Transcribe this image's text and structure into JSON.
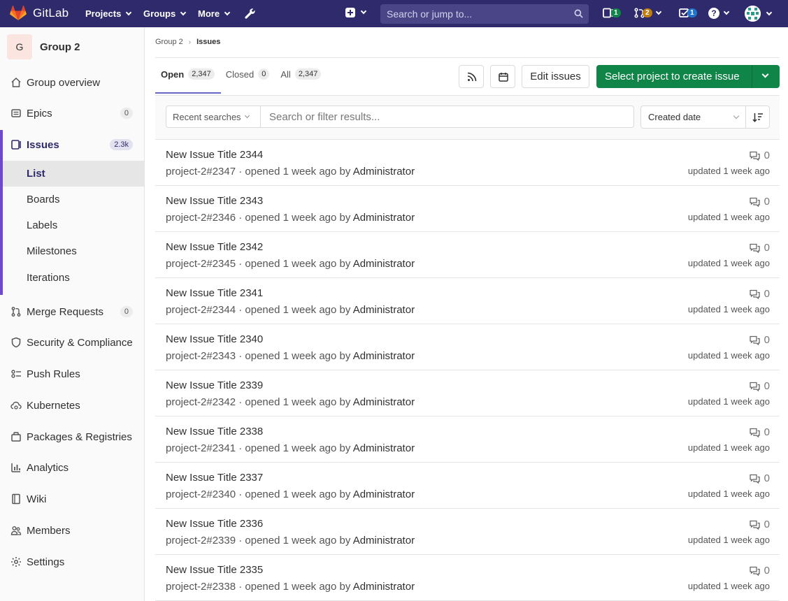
{
  "topbar": {
    "brand": "GitLab",
    "nav": [
      {
        "label": "Projects"
      },
      {
        "label": "Groups"
      },
      {
        "label": "More"
      }
    ],
    "search_placeholder": "Search or jump to...",
    "counters": {
      "issues": "1",
      "merge_requests": "2",
      "todos": "1"
    },
    "help_label": "?"
  },
  "sidebar": {
    "group_initial": "G",
    "group_name": "Group 2",
    "items": [
      {
        "label": "Group overview",
        "icon": "home-icon"
      },
      {
        "label": "Epics",
        "icon": "epic-icon",
        "badge": "0"
      },
      {
        "label": "Issues",
        "icon": "issues-icon",
        "badge": "2.3k"
      },
      {
        "label": "Merge Requests",
        "icon": "merge-request-icon",
        "badge": "0"
      },
      {
        "label": "Security & Compliance",
        "icon": "shield-icon"
      },
      {
        "label": "Push Rules",
        "icon": "push-rules-icon"
      },
      {
        "label": "Kubernetes",
        "icon": "cloud-gear-icon"
      },
      {
        "label": "Packages & Registries",
        "icon": "package-icon"
      },
      {
        "label": "Analytics",
        "icon": "chart-icon"
      },
      {
        "label": "Wiki",
        "icon": "book-icon"
      },
      {
        "label": "Members",
        "icon": "users-icon"
      },
      {
        "label": "Settings",
        "icon": "gear-icon"
      }
    ],
    "issues_sub": [
      {
        "label": "List"
      },
      {
        "label": "Boards"
      },
      {
        "label": "Labels"
      },
      {
        "label": "Milestones"
      },
      {
        "label": "Iterations"
      }
    ]
  },
  "breadcrumb": {
    "parent": "Group 2",
    "current": "Issues"
  },
  "tabs": [
    {
      "label": "Open",
      "count": "2,347"
    },
    {
      "label": "Closed",
      "count": "0"
    },
    {
      "label": "All",
      "count": "2,347"
    }
  ],
  "actions": {
    "edit_issues": "Edit issues",
    "create_issue": "Select project to create issue"
  },
  "filter": {
    "recent_searches": "Recent searches",
    "placeholder": "Search or filter results...",
    "sort": "Created date"
  },
  "issues": [
    {
      "title": "New Issue Title 2344",
      "ref": "project-2#2347",
      "opened": " · opened 1 week ago by ",
      "author": "Administrator",
      "comments": "0",
      "updated": "updated 1 week ago"
    },
    {
      "title": "New Issue Title 2343",
      "ref": "project-2#2346",
      "opened": " · opened 1 week ago by ",
      "author": "Administrator",
      "comments": "0",
      "updated": "updated 1 week ago"
    },
    {
      "title": "New Issue Title 2342",
      "ref": "project-2#2345",
      "opened": " · opened 1 week ago by ",
      "author": "Administrator",
      "comments": "0",
      "updated": "updated 1 week ago"
    },
    {
      "title": "New Issue Title 2341",
      "ref": "project-2#2344",
      "opened": " · opened 1 week ago by ",
      "author": "Administrator",
      "comments": "0",
      "updated": "updated 1 week ago"
    },
    {
      "title": "New Issue Title 2340",
      "ref": "project-2#2343",
      "opened": " · opened 1 week ago by ",
      "author": "Administrator",
      "comments": "0",
      "updated": "updated 1 week ago"
    },
    {
      "title": "New Issue Title 2339",
      "ref": "project-2#2342",
      "opened": " · opened 1 week ago by ",
      "author": "Administrator",
      "comments": "0",
      "updated": "updated 1 week ago"
    },
    {
      "title": "New Issue Title 2338",
      "ref": "project-2#2341",
      "opened": " · opened 1 week ago by ",
      "author": "Administrator",
      "comments": "0",
      "updated": "updated 1 week ago"
    },
    {
      "title": "New Issue Title 2337",
      "ref": "project-2#2340",
      "opened": " · opened 1 week ago by ",
      "author": "Administrator",
      "comments": "0",
      "updated": "updated 1 week ago"
    },
    {
      "title": "New Issue Title 2336",
      "ref": "project-2#2339",
      "opened": " · opened 1 week ago by ",
      "author": "Administrator",
      "comments": "0",
      "updated": "updated 1 week ago"
    },
    {
      "title": "New Issue Title 2335",
      "ref": "project-2#2338",
      "opened": " · opened 1 week ago by ",
      "author": "Administrator",
      "comments": "0",
      "updated": "updated 1 week ago"
    }
  ],
  "colors": {
    "navbar": "#2f2a6b",
    "primary_green": "#108548",
    "active_accent": "#6e49cb"
  }
}
